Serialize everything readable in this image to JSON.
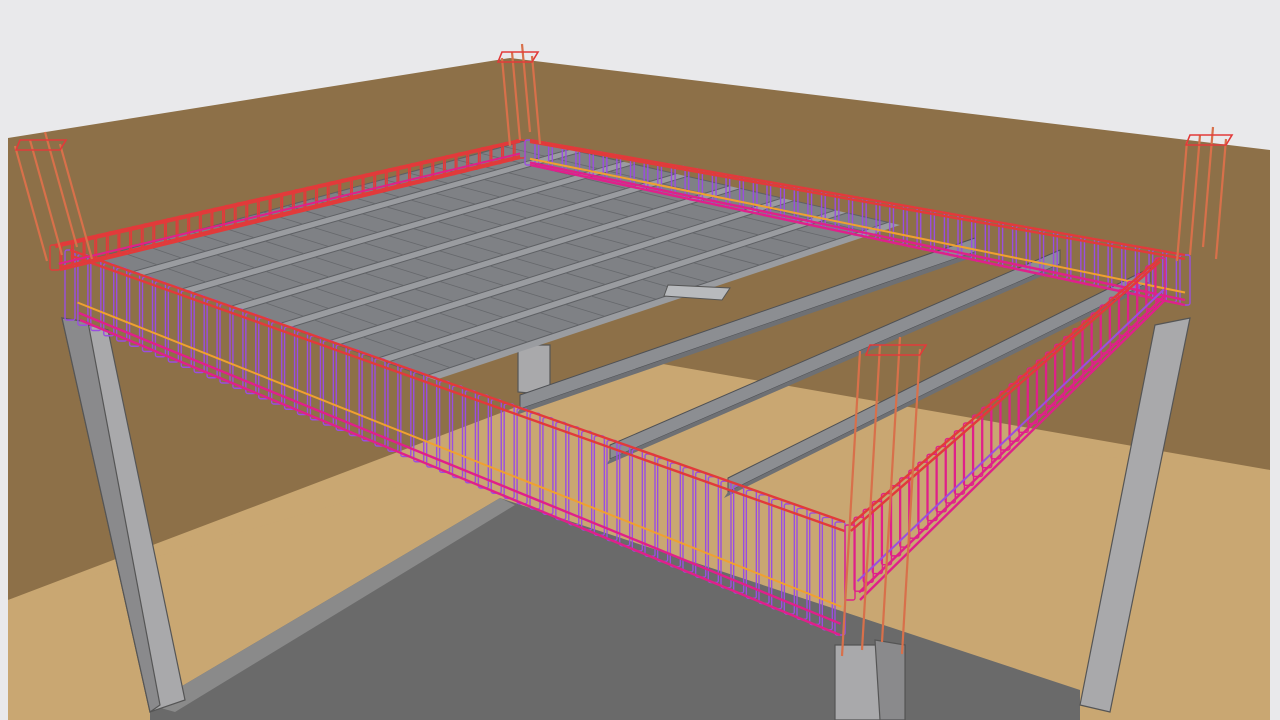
{
  "scene": {
    "kind": "3d-structural-model",
    "subject": "reinforced-concrete-slab-frame",
    "colors": {
      "sky": "#e9e9eb",
      "ground_far": "#8d7048",
      "ground_near": "#c9a772",
      "slab_floor": "#6a6a6a",
      "concrete": "#a9a9ab",
      "concrete_dark": "#8a8a8c",
      "joist": "#8c8e92",
      "block": "#7f8185",
      "stirrup_purple": "#9a4ee0",
      "rebar_magenta": "#e0208a",
      "rebar_red": "#e23a3a",
      "rebar_orange": "#f0a030",
      "column_bar": "#d8704a"
    },
    "elements": {
      "columns": 4,
      "perimeter_beams": 4,
      "joists": 5,
      "exposed_joists": 3
    }
  }
}
